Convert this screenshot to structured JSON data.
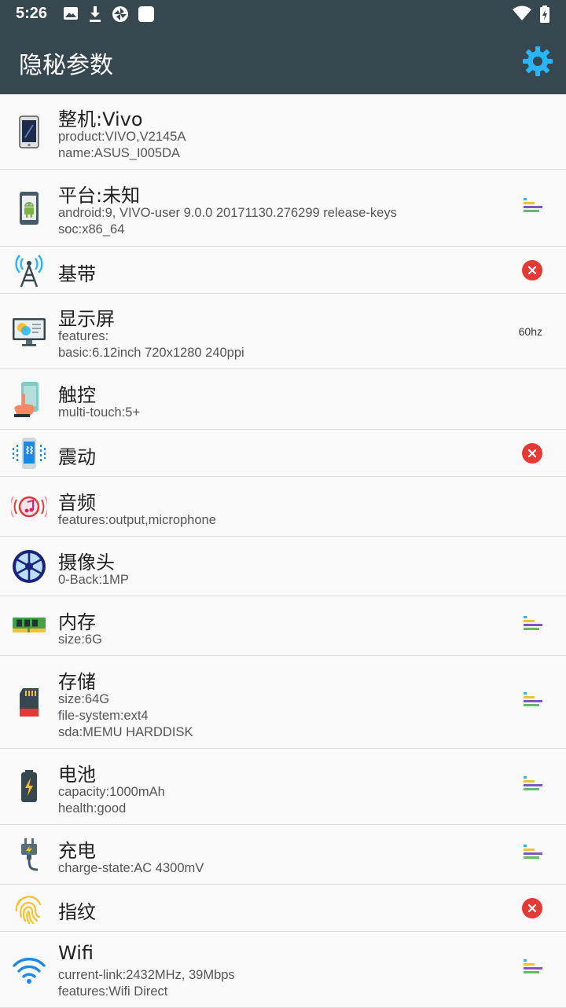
{
  "status_bar": {
    "time": "5:26",
    "left_icons": [
      "image-icon",
      "download-icon",
      "aperture-icon",
      "square-icon"
    ],
    "right_icons": [
      "wifi-icon",
      "battery-charging-icon"
    ]
  },
  "app_bar": {
    "title": "隐秘参数",
    "settings_icon": "gear-icon",
    "accent": "#29b6f6",
    "background": "#37474f"
  },
  "rows": [
    {
      "title": "整机:Vivo",
      "icon": "phone-icon",
      "lines": [
        "product:VIVO,V2145A",
        "name:ASUS_I005DA"
      ],
      "right": ""
    },
    {
      "title": "平台:未知",
      "icon": "android-icon",
      "lines": [
        "android:9, VIVO-user 9.0.0 20171130.276299 release-keys",
        "soc:x86_64"
      ],
      "right": "detail"
    },
    {
      "title": "基带",
      "icon": "antenna-tower-icon",
      "lines": [],
      "right": "error"
    },
    {
      "title": "显示屏",
      "icon": "monitor-icon",
      "lines": [
        "features:",
        "basic:6.12inch 720x1280 240ppi"
      ],
      "right": "text",
      "right_text": "60hz"
    },
    {
      "title": "触控",
      "icon": "touch-hand-icon",
      "lines": [
        "multi-touch:5+"
      ],
      "right": ""
    },
    {
      "title": "震动",
      "icon": "vibration-icon",
      "lines": [],
      "right": "error"
    },
    {
      "title": "音频",
      "icon": "audio-icon",
      "lines": [
        "features:output,microphone"
      ],
      "right": ""
    },
    {
      "title": "摄像头",
      "icon": "camera-aperture-icon",
      "lines": [
        "0-Back:1MP"
      ],
      "right": ""
    },
    {
      "title": "内存",
      "icon": "memory-stick-icon",
      "lines": [
        "size:6G"
      ],
      "right": "detail"
    },
    {
      "title": "存储",
      "icon": "sd-card-icon",
      "lines": [
        "size:64G",
        "file-system:ext4",
        "sda:MEMU HARDDISK"
      ],
      "right": "detail"
    },
    {
      "title": "电池",
      "icon": "battery-icon",
      "lines": [
        "capacity:1000mAh",
        "health:good"
      ],
      "right": "detail"
    },
    {
      "title": "充电",
      "icon": "plug-icon",
      "lines": [
        "charge-state:AC 4300mV"
      ],
      "right": "detail"
    },
    {
      "title": "指纹",
      "icon": "fingerprint-icon",
      "lines": [],
      "right": "error"
    },
    {
      "title": "Wifi",
      "icon": "wifi-icon",
      "lines": [
        "current-link:2432MHz, 39Mbps",
        "features:Wifi Direct"
      ],
      "right": "detail"
    }
  ]
}
